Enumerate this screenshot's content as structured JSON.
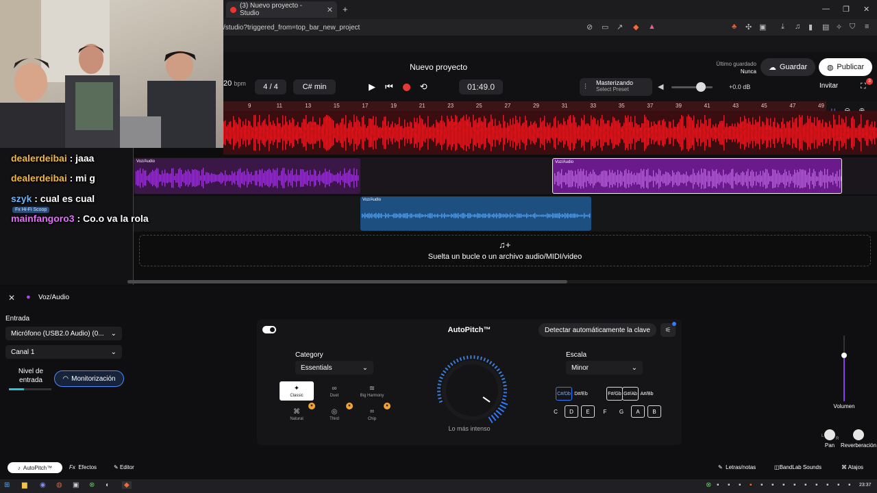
{
  "browser": {
    "tab_title": "(3) Nuevo proyecto - Studio",
    "url": "/studio?triggered_from=top_bar_new_project",
    "new_tab_label": "+",
    "close_tab": "✕",
    "win_min": "—",
    "win_max": "❐",
    "win_close": "✕"
  },
  "header": {
    "project_title": "Nuevo proyecto",
    "bpm_value": "20",
    "bpm_unit": "bpm",
    "time_signature": "4 / 4",
    "key": "C# min",
    "timecode": "01:49.0",
    "master_title": "Masterizando",
    "master_preset": "Select Preset",
    "volume_db": "+0.0 dB",
    "last_saved_label": "Último guardado",
    "last_saved_value": "Nunca",
    "save_label": "Guardar",
    "publish_label": "Publicar",
    "invite_label": "Invitar",
    "cart_count": "3"
  },
  "ruler": {
    "marks": [
      "9",
      "11",
      "13",
      "15",
      "17",
      "19",
      "21",
      "23",
      "25",
      "27",
      "29",
      "31",
      "33",
      "35",
      "37",
      "39",
      "41",
      "43",
      "45",
      "47",
      "49"
    ]
  },
  "tracks": {
    "clip1_label": "Voz/Audio",
    "clip2_label": "Voz/Audio",
    "clip3_label": "Voz/Audio",
    "drop_text": "Suelta un bucle o un archivo audio/MIDI/video"
  },
  "chat": [
    {
      "user": "dealerdeibai",
      "message": " : jaaa"
    },
    {
      "user": "dealerdeibai",
      "message": " : mi g"
    },
    {
      "user": "szyk",
      "message": " : cual es cual"
    },
    {
      "user": "mainfangoro3",
      "message": " : Co.o va la rola"
    }
  ],
  "fx_badge": "Fx Hi-Fi Scoop",
  "panel": {
    "track_name": "Voz/Audio",
    "input_label": "Entrada",
    "mic_value": "Micrófono (USB2.0 Audio) (0...",
    "channel_value": "Canal 1",
    "input_level_label": "Nivel de entrada",
    "input_level": 0.35,
    "monitoring_label": "Monitorización"
  },
  "autopitch": {
    "title": "AutoPitch™",
    "detect_label": "Detectar automáticamente la clave",
    "category_label": "Category",
    "category_value": "Essentials",
    "presets": [
      {
        "name": "Classic",
        "icon": "sparkle-icon"
      },
      {
        "name": "Duet",
        "icon": "duet-icon"
      },
      {
        "name": "Big Harmony",
        "icon": "harmony-icon"
      },
      {
        "name": "Natural",
        "icon": "natural-icon"
      },
      {
        "name": "Third",
        "icon": "third-icon"
      },
      {
        "name": "Chip",
        "icon": "chip-icon"
      }
    ],
    "dial_label": "Lo más intenso",
    "scale_label": "Escala",
    "scale_value": "Minor",
    "sharp_keys": [
      {
        "top": "C#",
        "bottom": "Db"
      },
      {
        "top": "D#",
        "bottom": "Eb"
      },
      {
        "top": "F#",
        "bottom": "Gb"
      },
      {
        "top": "G#",
        "bottom": "Ab"
      },
      {
        "top": "A#",
        "bottom": "Bb"
      }
    ],
    "natural_keys": [
      "C",
      "D",
      "E",
      "F",
      "G",
      "A",
      "B"
    ]
  },
  "mixer": {
    "volume_label": "Volumen",
    "volume_level": 0.7,
    "pan_label": "Pan",
    "pan_left": "L",
    "pan_right": "R",
    "reverb_label": "Reverberación"
  },
  "bottombar": {
    "autopitch_tab": "AutoPitch™",
    "fx_prefix": "Fx",
    "effects_tab": "Efectos",
    "editor_tab": "Editor",
    "lyrics_label": "Letras/notas",
    "sounds_label": "BandLab Sounds",
    "shortcuts_label": "Atajos"
  },
  "taskbar": {
    "clock": "23:37"
  },
  "colors": {
    "accent_purple": "#8b3cf0",
    "accent_blue": "#2e7dff",
    "record_red": "#e53935",
    "master_wave_red": "#e0202a"
  }
}
